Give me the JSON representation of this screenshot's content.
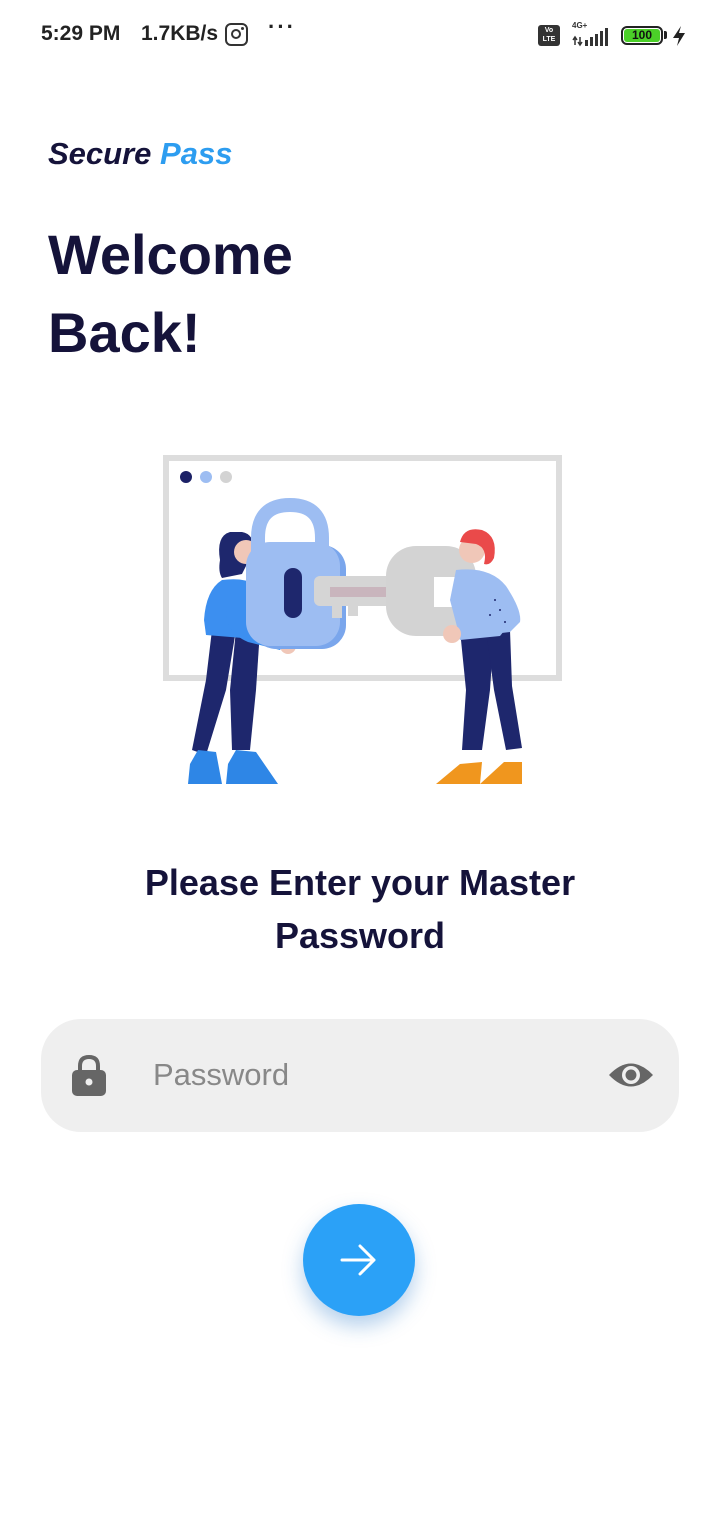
{
  "status_bar": {
    "time": "5:29 PM",
    "net_speed": "1.7KB/s",
    "notification_icons": [
      "instagram-icon",
      "more-dots-icon"
    ],
    "overflow": "···",
    "volte": "Vo LTE",
    "network": "4G+",
    "battery": "100",
    "charging": true
  },
  "header": {
    "brand_first": "Secure",
    "brand_second": "Pass",
    "welcome_line1": "Welcome",
    "welcome_line2": "Back!"
  },
  "prompt": {
    "line1": "Please Enter your Master",
    "line2": "Password"
  },
  "password_field": {
    "placeholder": "Password",
    "value": "",
    "leading_icon": "lock-icon",
    "trailing_icon": "eye-icon"
  },
  "submit": {
    "icon": "arrow-right-icon"
  },
  "colors": {
    "accent": "#2ba1f7",
    "brand_accent": "#2d9df0",
    "heading": "#15133a",
    "field_bg": "#efefef"
  }
}
